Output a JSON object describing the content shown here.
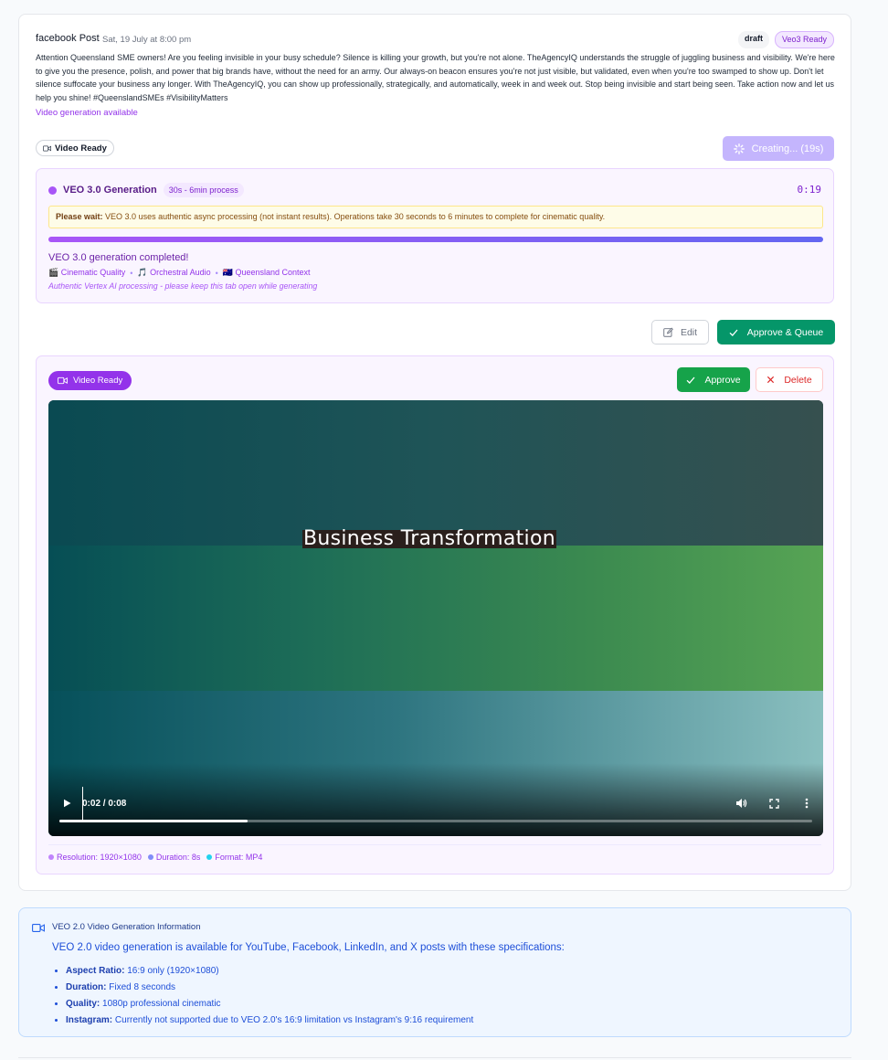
{
  "post": {
    "platform": "facebook Post",
    "date": "Sat, 19 July at 8:00 pm",
    "status_badge": "draft",
    "veo_badge": "Veo3 Ready",
    "content": "Attention Queensland SME owners! Are you feeling invisible in your busy schedule? Silence is killing your growth, but you're not alone. TheAgencyIQ understands the struggle of juggling business and visibility. We're here to give you the presence, polish, and power that big brands have, without the need for an army. Our always-on beacon ensures you're not just visible, but validated, even when you're too swamped to show up. Don't let silence suffocate your business any longer. With TheAgencyIQ, you can show up professionally, strategically, and automatically, week in and week out. Stop being invisible and start being seen. Take action now and let us help you shine! #QueenslandSMEs #VisibilityMatters",
    "video_available_link": "Video generation available",
    "video_ready_chip": "Video Ready",
    "creating_button": "Creating... (19s)"
  },
  "generation": {
    "title": "VEO 3.0 Generation",
    "process_badge": "30s - 6min process",
    "timer": "0:19",
    "wait_label": "Please wait:",
    "wait_text": "VEO 3.0 uses authentic async processing (not instant results). Operations take 30 seconds to 6 minutes to complete for cinematic quality.",
    "progress": 1.0,
    "completed_text": "VEO 3.0 generation completed!",
    "features": [
      "🎬 Cinematic Quality",
      "🎵 Orchestral Audio",
      "🇦🇺 Queensland Context"
    ],
    "feature_sep": "•",
    "note": "Authentic Vertex AI processing - please keep this tab open while generating"
  },
  "actions": {
    "edit": "Edit",
    "approve_queue": "Approve & Queue"
  },
  "video_panel": {
    "badge": "Video Ready",
    "approve": "Approve",
    "delete": "Delete",
    "caption": "Business Transformation",
    "time": "0:02 / 0:08",
    "played_fraction": 0.25,
    "specs": [
      {
        "label": "Resolution: 1920×1080",
        "color": "#c084fc"
      },
      {
        "label": "Duration: 8s",
        "color": "#818cf8"
      },
      {
        "label": "Format: MP4",
        "color": "#22d3ee"
      }
    ]
  },
  "info": {
    "title": "VEO 2.0 Video Generation Information",
    "description": "VEO 2.0 video generation is available for YouTube, Facebook, LinkedIn, and X posts with these specifications:",
    "items": [
      {
        "label": "Aspect Ratio:",
        "value": "16:9 only (1920×1080)"
      },
      {
        "label": "Duration:",
        "value": "Fixed 8 seconds"
      },
      {
        "label": "Quality:",
        "value": "1080p professional cinematic"
      },
      {
        "label": "Instagram:",
        "value": "Currently not supported due to VEO 2.0's 16:9 limitation vs Instagram's 9:16 requirement"
      }
    ]
  },
  "colors": {
    "purple_accent": "#9333ea",
    "approve_green": "#16a34a",
    "approve_queue_green": "#059669",
    "delete_red": "#dc2626",
    "info_blue": "#1d4ed8"
  }
}
